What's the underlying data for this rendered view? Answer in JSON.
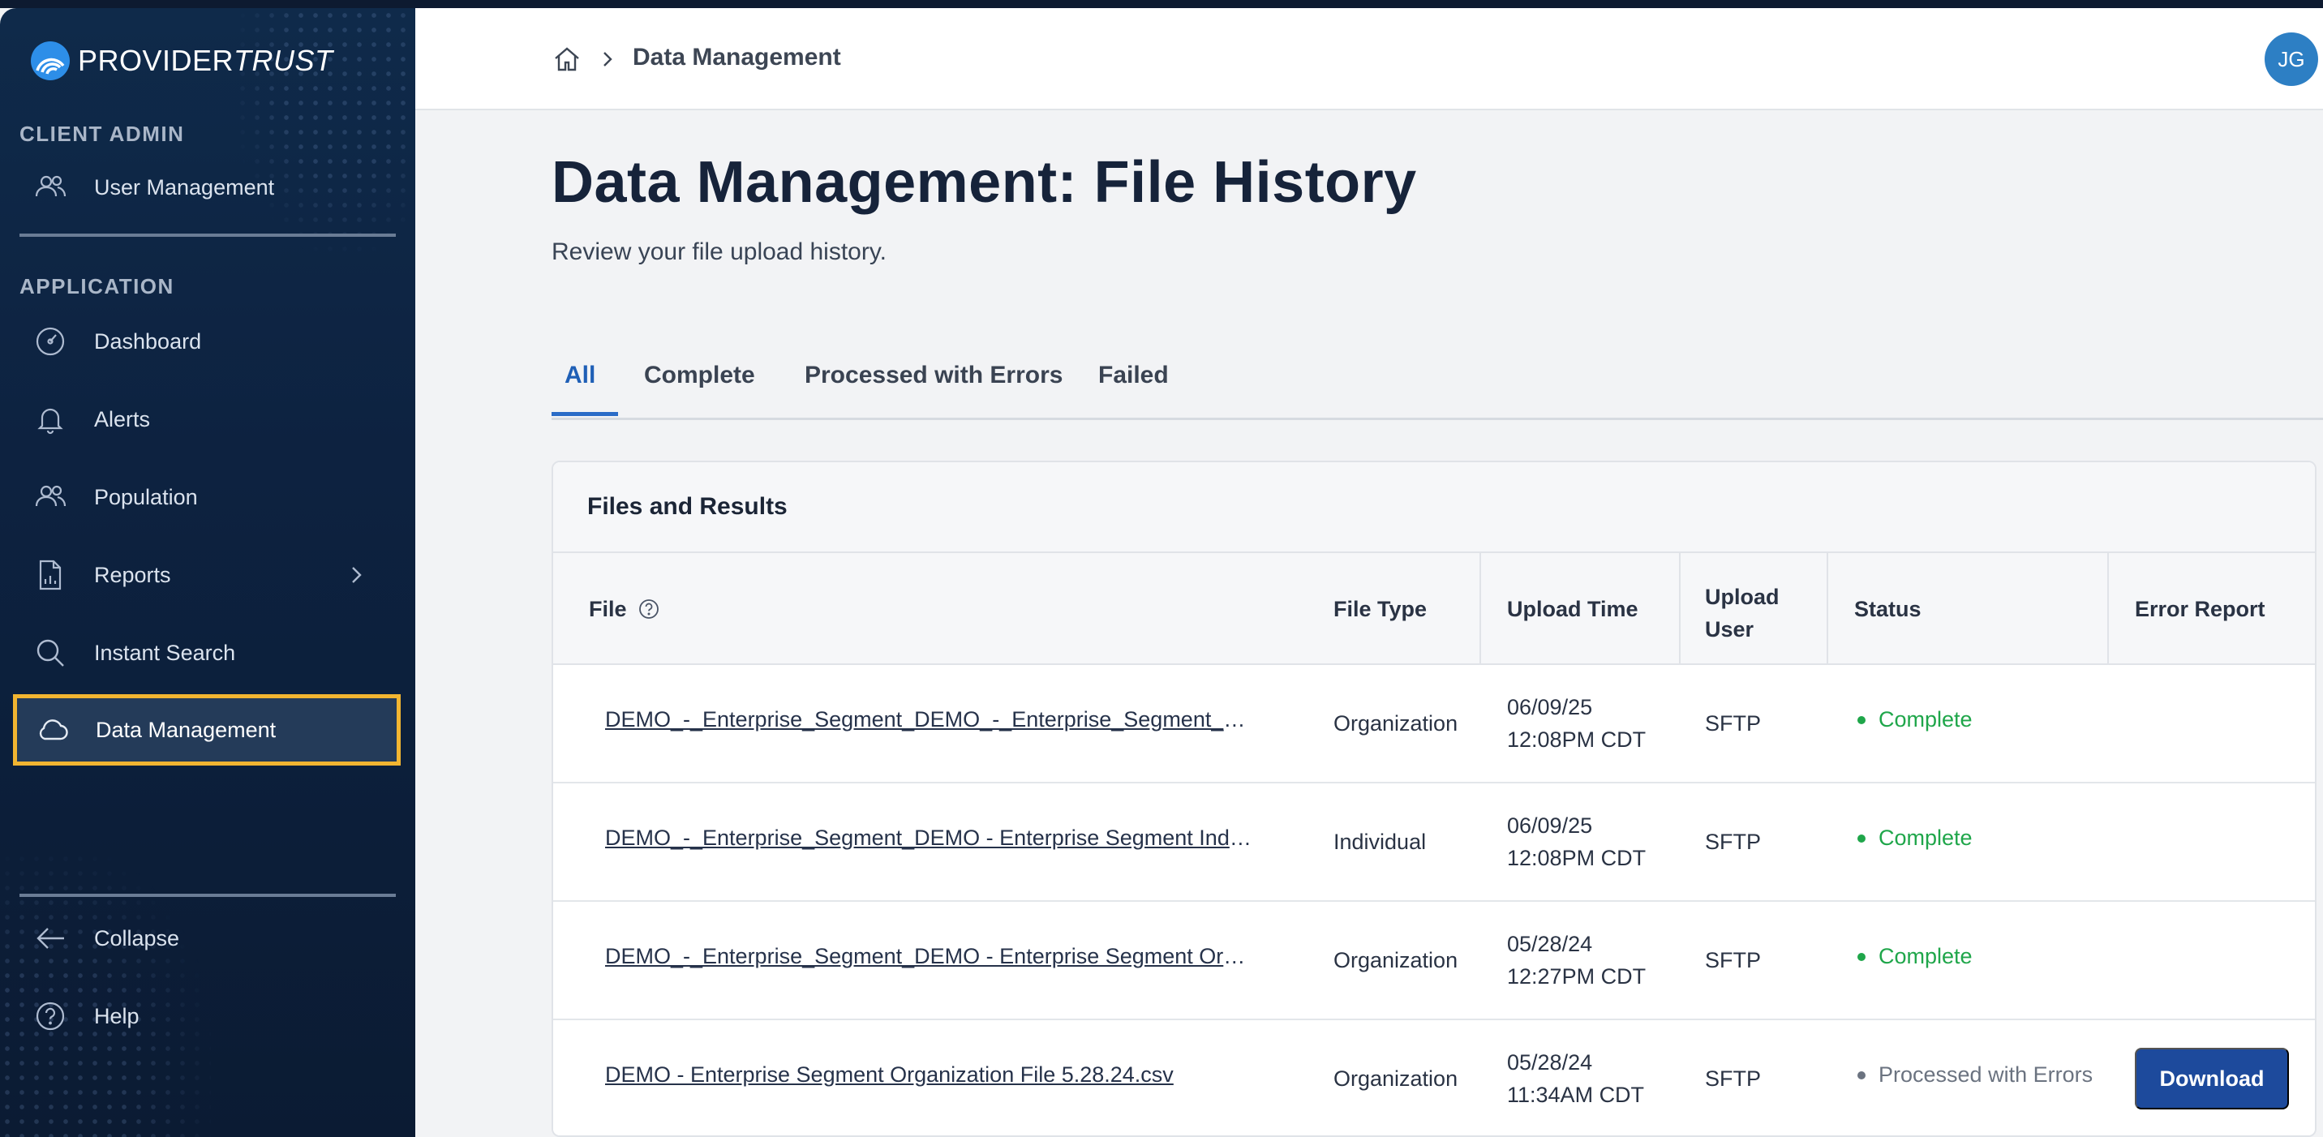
{
  "brand": {
    "name_bold": "PROVIDER",
    "name_light": "TRUST"
  },
  "sidebar": {
    "sections": [
      {
        "label": "CLIENT ADMIN"
      },
      {
        "label": "APPLICATION"
      }
    ],
    "admin_items": [
      {
        "label": "User Management",
        "icon": "users-icon"
      }
    ],
    "app_items": [
      {
        "label": "Dashboard",
        "icon": "gauge-icon"
      },
      {
        "label": "Alerts",
        "icon": "bell-icon"
      },
      {
        "label": "Population",
        "icon": "users-icon"
      },
      {
        "label": "Reports",
        "icon": "document-chart-icon",
        "has_submenu": true
      },
      {
        "label": "Instant Search",
        "icon": "search-icon"
      },
      {
        "label": "Data Management",
        "icon": "cloud-icon",
        "active": true
      }
    ],
    "footer_items": [
      {
        "label": "Collapse",
        "icon": "arrow-left-icon"
      },
      {
        "label": "Help",
        "icon": "help-circle-icon"
      }
    ]
  },
  "header": {
    "breadcrumb_current": "Data Management",
    "avatar_initials": "JG"
  },
  "page": {
    "title": "Data Management: File History",
    "subtitle": "Review your file upload history."
  },
  "tabs": [
    {
      "label": "All",
      "active": true
    },
    {
      "label": "Complete"
    },
    {
      "label": "Processed with Errors"
    },
    {
      "label": "Failed"
    }
  ],
  "table": {
    "title": "Files and Results",
    "columns": [
      "File",
      "File Type",
      "Upload Time",
      "Upload User",
      "Status",
      "Error Report"
    ],
    "upload_user_lines": [
      "Upload",
      "User"
    ],
    "rows": [
      {
        "file": "DEMO_-_Enterprise_Segment_DEMO_-_Enterprise_Segment_DE…",
        "type": "Organization",
        "date": "06/09/25",
        "time": "12:08PM CDT",
        "user": "SFTP",
        "status": "Complete",
        "error_report": ""
      },
      {
        "file": "DEMO_-_Enterprise_Segment_DEMO - Enterprise Segment Individ…",
        "type": "Individual",
        "date": "06/09/25",
        "time": "12:08PM CDT",
        "user": "SFTP",
        "status": "Complete",
        "error_report": ""
      },
      {
        "file": "DEMO_-_Enterprise_Segment_DEMO - Enterprise Segment Organi…",
        "type": "Organization",
        "date": "05/28/24",
        "time": "12:27PM CDT",
        "user": "SFTP",
        "status": "Complete",
        "error_report": ""
      },
      {
        "file": "DEMO - Enterprise Segment Organization File 5.28.24.csv",
        "type": "Organization",
        "date": "05/28/24",
        "time": "11:34AM CDT",
        "user": "SFTP",
        "status": "Processed with Errors",
        "error_report": "Download"
      }
    ]
  },
  "colors": {
    "sidebar_bg": "#0d2240",
    "active_outline": "#f2b531",
    "accent_blue": "#1f5fb6",
    "status_complete": "#1fa64a",
    "status_errors": "#6b7380",
    "download_button": "#1d4a9c"
  }
}
